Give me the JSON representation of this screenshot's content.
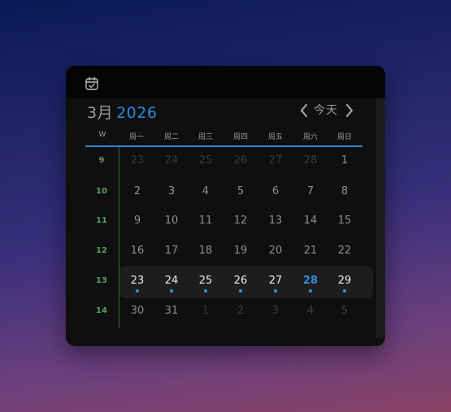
{
  "header": {
    "month": "3月",
    "year": "2026",
    "today": "今天"
  },
  "weekday_labels": [
    "W",
    "周一",
    "周二",
    "周三",
    "周四",
    "周五",
    "周六",
    "周日"
  ],
  "weeks": [
    {
      "num": "9",
      "days": [
        "23",
        "24",
        "25",
        "26",
        "27",
        "28",
        "1"
      ]
    },
    {
      "num": "10",
      "days": [
        "2",
        "3",
        "4",
        "5",
        "6",
        "7",
        "8"
      ]
    },
    {
      "num": "11",
      "days": [
        "9",
        "10",
        "11",
        "12",
        "13",
        "14",
        "15"
      ]
    },
    {
      "num": "12",
      "days": [
        "16",
        "17",
        "18",
        "19",
        "20",
        "21",
        "22"
      ]
    },
    {
      "num": "13",
      "days": [
        "23",
        "24",
        "25",
        "26",
        "27",
        "28",
        "29"
      ]
    },
    {
      "num": "14",
      "days": [
        "30",
        "31",
        "1",
        "2",
        "3",
        "4",
        "5"
      ]
    }
  ],
  "colors": {
    "accent": "#2a8ad4",
    "week_number": "#5aa05a"
  }
}
